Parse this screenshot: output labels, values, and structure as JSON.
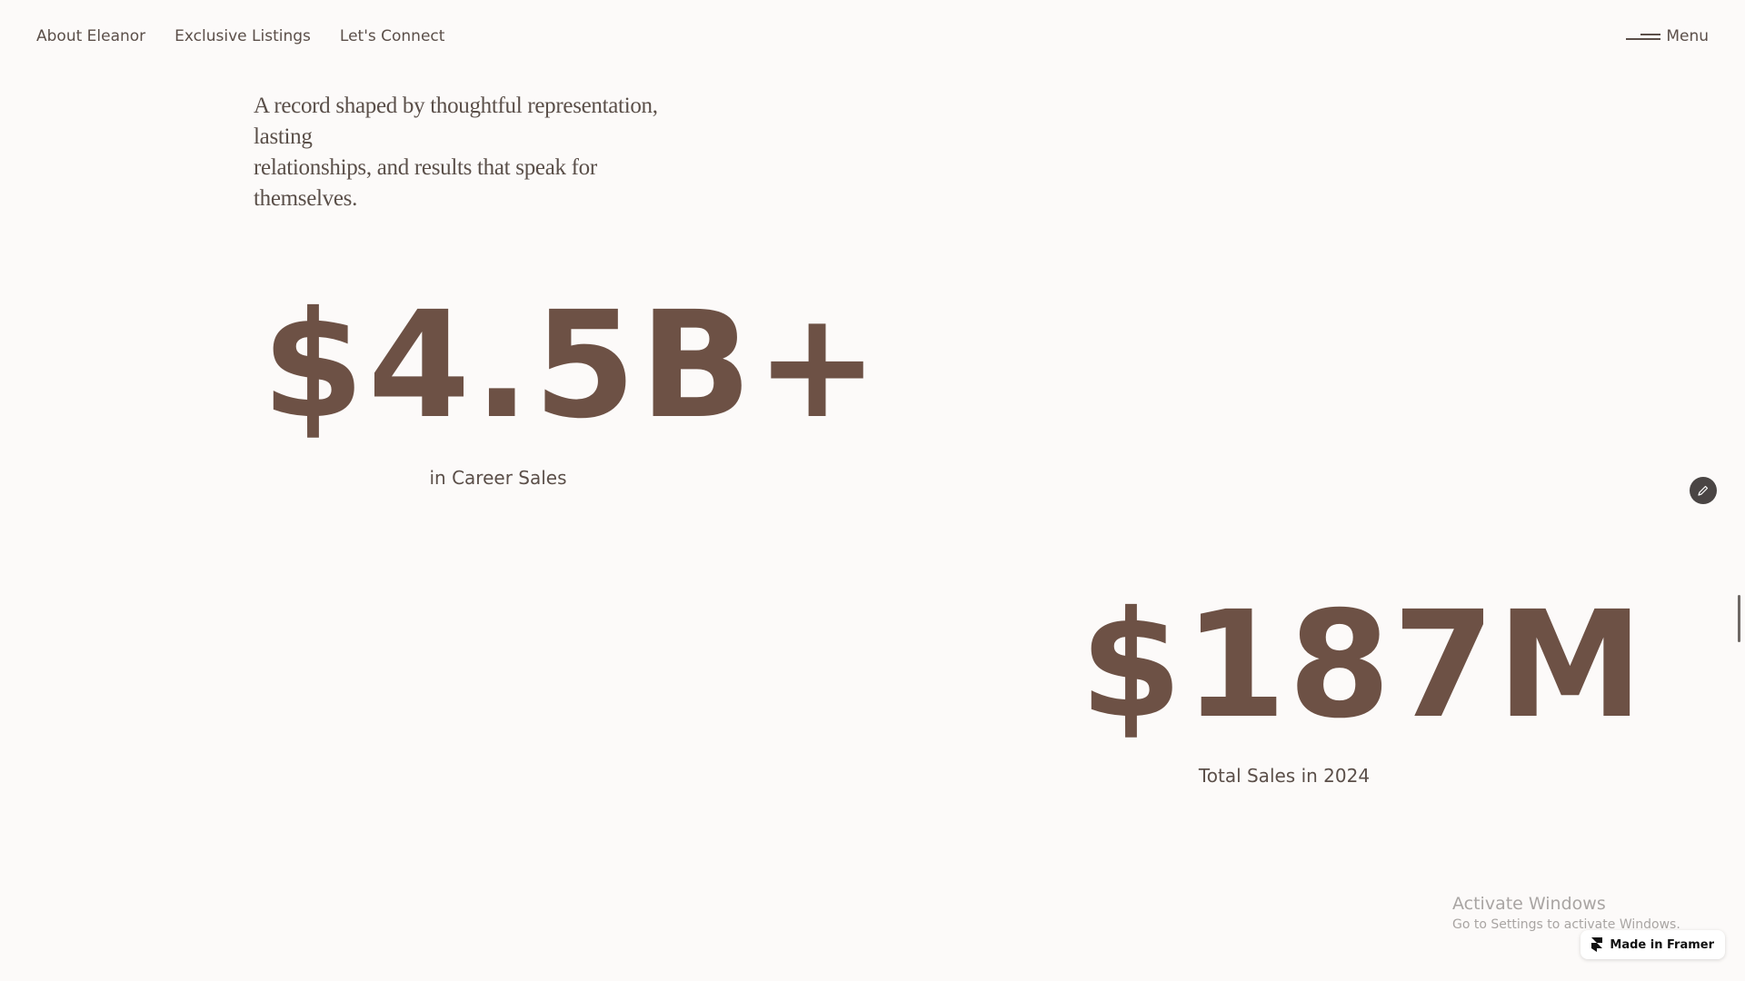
{
  "nav": {
    "items": [
      {
        "label": "About Eleanor"
      },
      {
        "label": "Exclusive Listings"
      },
      {
        "label": "Let's Connect"
      }
    ],
    "menu_label": "Menu"
  },
  "intro": {
    "line1": "A record shaped by thoughtful representation, lasting",
    "line2": "relationships, and results that speak for themselves."
  },
  "stats": [
    {
      "value": "$4.5B+",
      "label": "in Career Sales"
    },
    {
      "value": "$187M",
      "label": "Total Sales in 2024"
    }
  ],
  "system": {
    "activate_title": "Activate Windows",
    "activate_sub": "Go to Settings to activate Windows."
  },
  "badge": {
    "label": "Made in Framer"
  },
  "colors": {
    "background": "#fcfaf9",
    "stat": "#6d5145",
    "text": "#5b4f49"
  },
  "icons": {
    "menu": "hamburger-lines-icon",
    "edit": "pencil-icon",
    "framer": "framer-logo-icon"
  }
}
